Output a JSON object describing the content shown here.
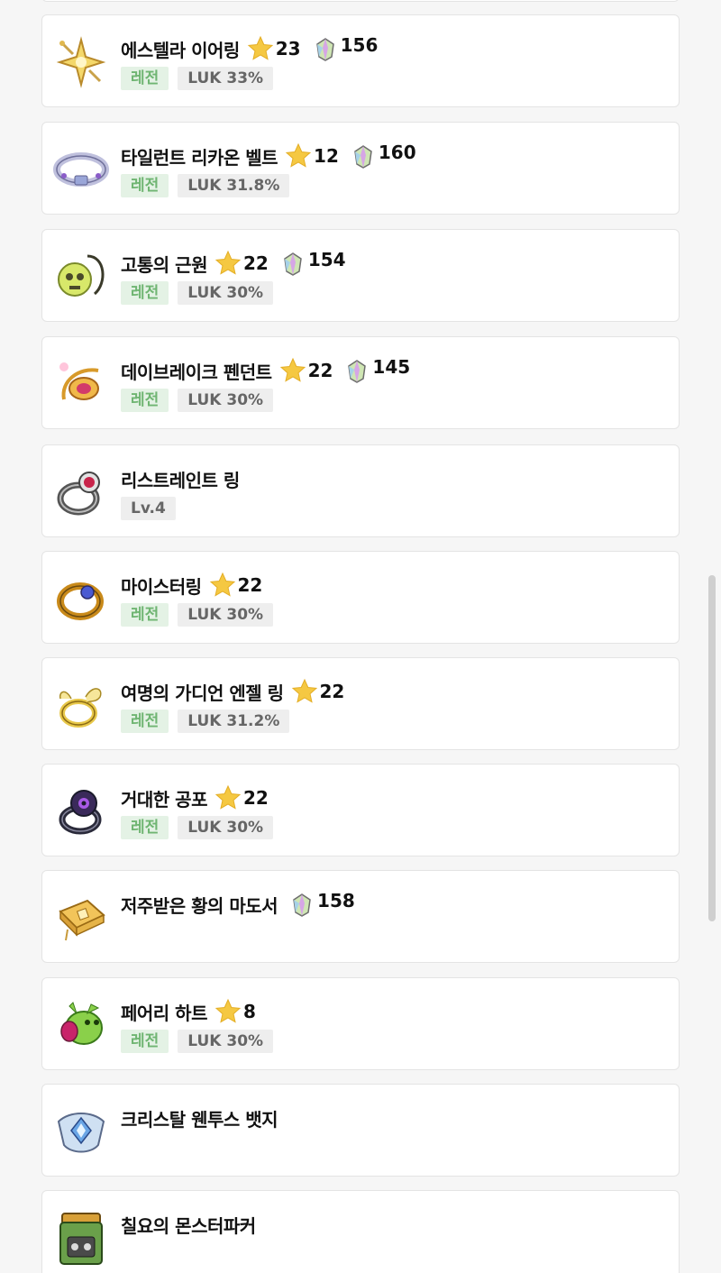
{
  "items": [
    {
      "name": "에스텔라 이어링",
      "icon": "estella-earring-icon",
      "star": "23",
      "potential": "156",
      "grade": "레전",
      "option": "LUK 33%"
    },
    {
      "name": "타일런트 리카온 벨트",
      "icon": "tyrant-lycaon-belt-icon",
      "star": "12",
      "potential": "160",
      "grade": "레전",
      "option": "LUK 31.8%"
    },
    {
      "name": "고통의 근원",
      "icon": "source-of-suffering-icon",
      "star": "22",
      "potential": "154",
      "grade": "레전",
      "option": "LUK 30%"
    },
    {
      "name": "데이브레이크 펜던트",
      "icon": "daybreak-pendant-icon",
      "star": "22",
      "potential": "145",
      "grade": "레전",
      "option": "LUK 30%"
    },
    {
      "name": "리스트레인트 링",
      "icon": "restraint-ring-icon",
      "level": "Lv.4"
    },
    {
      "name": "마이스터링",
      "icon": "meister-ring-icon",
      "star": "22",
      "grade": "레전",
      "option": "LUK 30%"
    },
    {
      "name": "여명의 가디언 엔젤 링",
      "icon": "guardian-angel-ring-icon",
      "star": "22",
      "grade": "레전",
      "option": "LUK 31.2%"
    },
    {
      "name": "거대한 공포",
      "icon": "giant-fear-icon",
      "star": "22",
      "grade": "레전",
      "option": "LUK 30%"
    },
    {
      "name": "저주받은 황의 마도서",
      "icon": "cursed-grimoire-icon",
      "potential": "158"
    },
    {
      "name": "페어리 하트",
      "icon": "fairy-heart-icon",
      "star": "8",
      "grade": "레전",
      "option": "LUK 30%"
    },
    {
      "name": "크리스탈 웬투스 뱃지",
      "icon": "crystal-ventus-badge-icon"
    },
    {
      "name": "칠요의 몬스터파커",
      "icon": "monster-parker-icon"
    }
  ],
  "colors": {
    "star": "#f5c842",
    "grade_bg": "#e4f2e5",
    "grade_text": "#6fb572",
    "tag_bg": "#eeeeee"
  }
}
